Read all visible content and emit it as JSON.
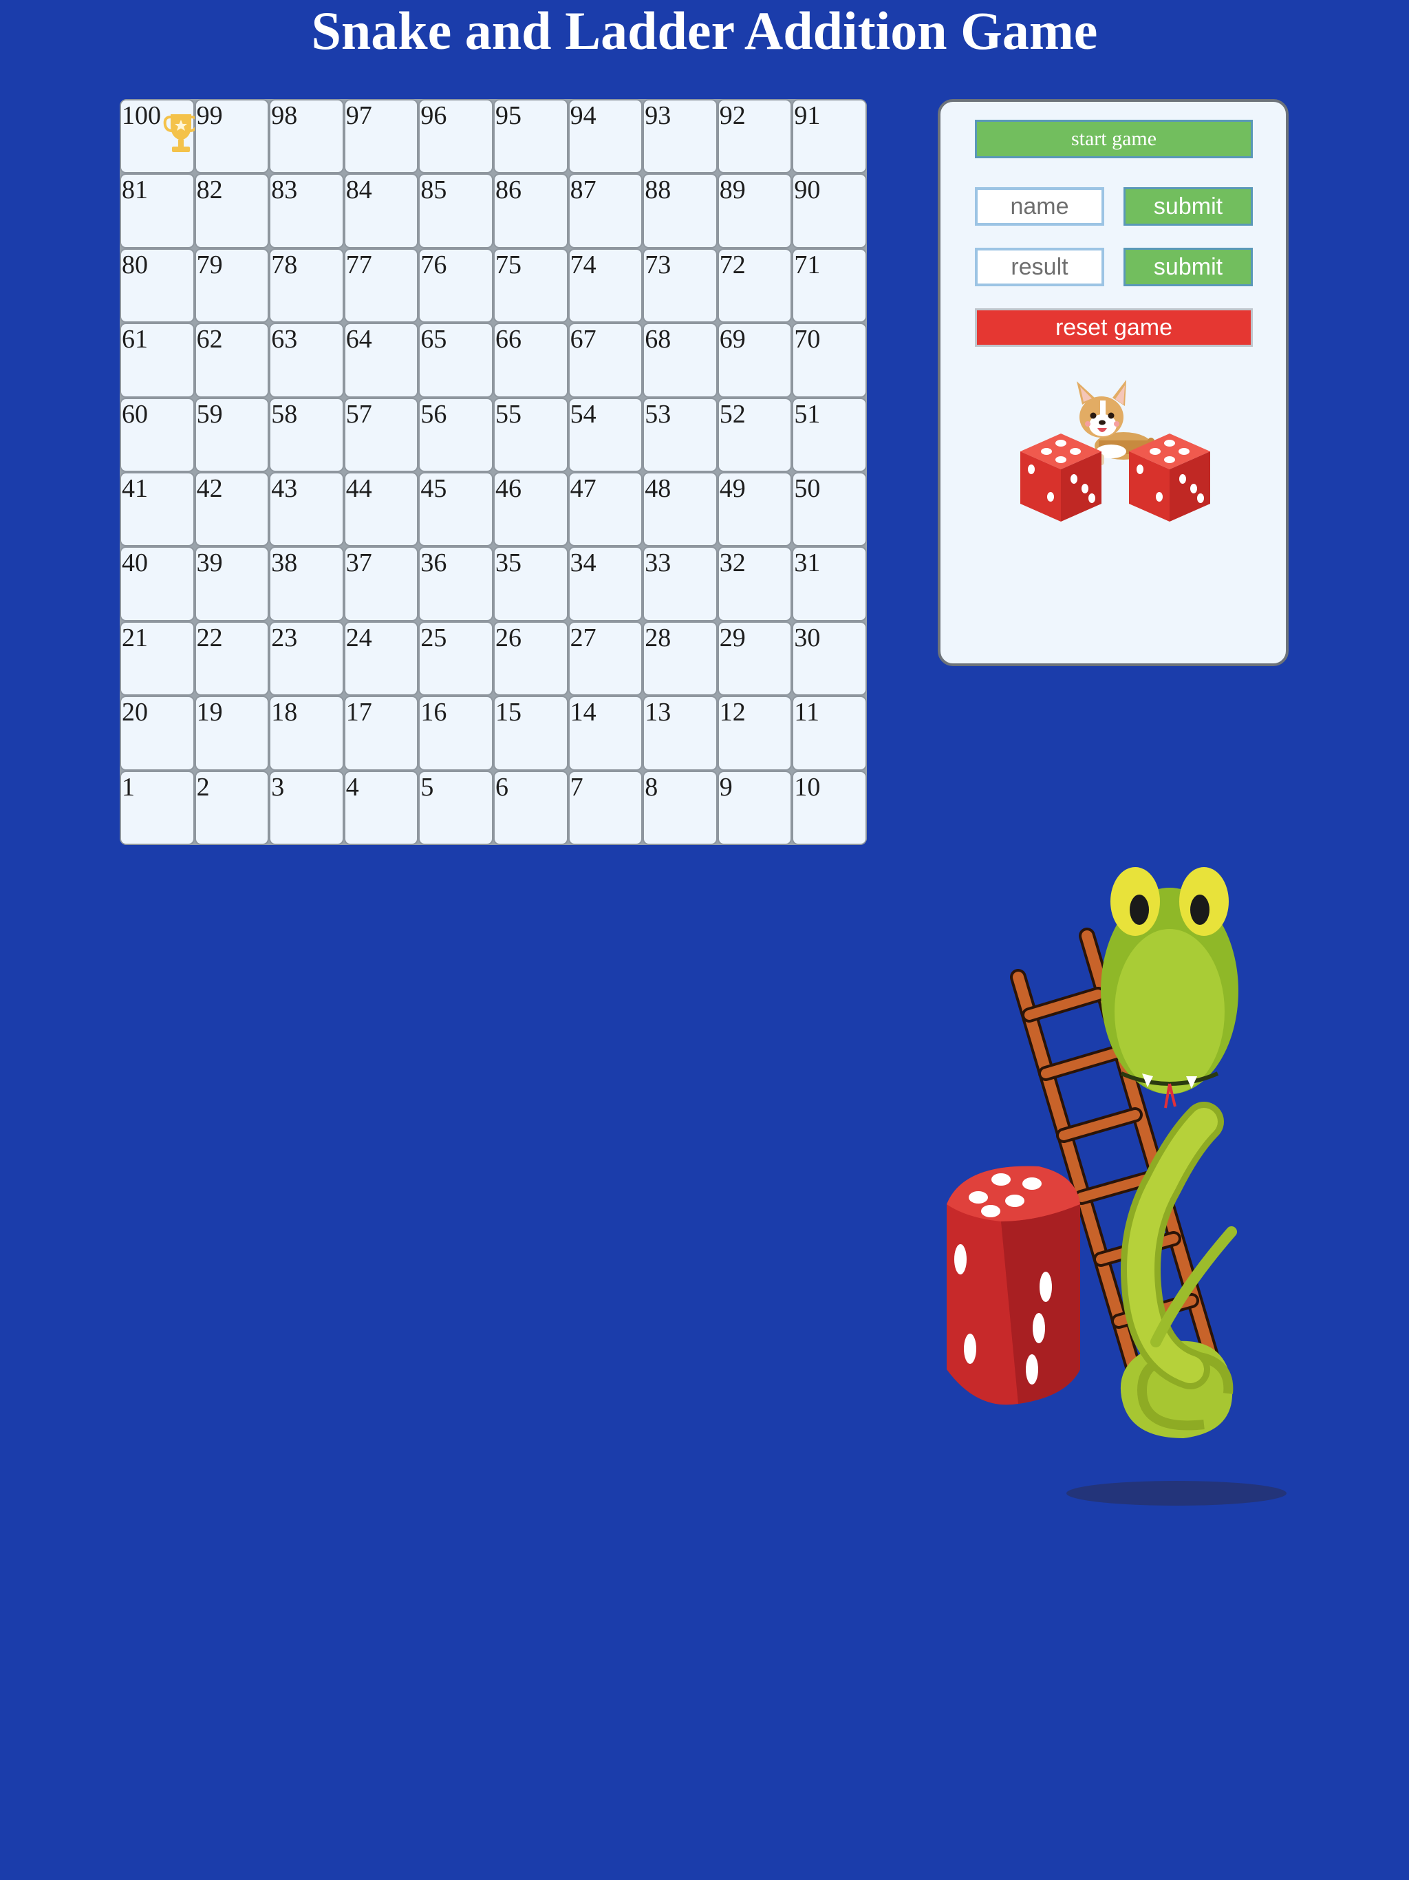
{
  "header": {
    "title": "Snake and Ladder Addition Game"
  },
  "board": {
    "rows": [
      [
        "100",
        "99",
        "98",
        "97",
        "96",
        "95",
        "94",
        "93",
        "92",
        "91"
      ],
      [
        "81",
        "82",
        "83",
        "84",
        "85",
        "86",
        "87",
        "88",
        "89",
        "90"
      ],
      [
        "80",
        "79",
        "78",
        "77",
        "76",
        "75",
        "74",
        "73",
        "72",
        "71"
      ],
      [
        "61",
        "62",
        "63",
        "64",
        "65",
        "66",
        "67",
        "68",
        "69",
        "70"
      ],
      [
        "60",
        "59",
        "58",
        "57",
        "56",
        "55",
        "54",
        "53",
        "52",
        "51"
      ],
      [
        "41",
        "42",
        "43",
        "44",
        "45",
        "46",
        "47",
        "48",
        "49",
        "50"
      ],
      [
        "40",
        "39",
        "38",
        "37",
        "36",
        "35",
        "34",
        "33",
        "32",
        "31"
      ],
      [
        "21",
        "22",
        "23",
        "24",
        "25",
        "26",
        "27",
        "28",
        "29",
        "30"
      ],
      [
        "20",
        "19",
        "18",
        "17",
        "16",
        "15",
        "14",
        "13",
        "12",
        "11"
      ],
      [
        "1",
        "2",
        "3",
        "4",
        "5",
        "6",
        "7",
        "8",
        "9",
        "10"
      ]
    ],
    "goal_icon": "trophy-icon"
  },
  "panel": {
    "start_label": "start game",
    "name_placeholder": "name",
    "name_submit_label": "submit",
    "result_placeholder": "result",
    "result_submit_label": "submit",
    "reset_label": "reset game",
    "player_icon": "corgi-dog-icon",
    "dice": [
      {
        "icon": "red-die-icon",
        "value": 3
      },
      {
        "icon": "red-die-icon",
        "value": 3
      }
    ]
  },
  "colors": {
    "background": "#1b3dab",
    "start_button": "#72be5e",
    "submit_button": "#72be5e",
    "reset_button": "#e53732",
    "cell": "#eff6fd"
  }
}
